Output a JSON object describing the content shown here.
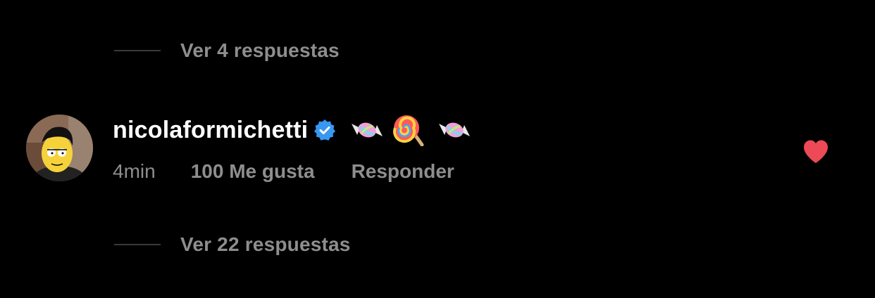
{
  "thread": {
    "replies_top": "Ver 4 respuestas",
    "replies_bottom": "Ver 22 respuestas"
  },
  "comment": {
    "username": "nicolaformichetti",
    "verified": true,
    "text_icons": [
      "candy-icon",
      "lollipop-icon",
      "candy-icon"
    ],
    "time": "4min",
    "likes": "100 Me gusta",
    "reply_label": "Responder",
    "liked": true
  },
  "colors": {
    "background": "#000000",
    "muted": "#8e8e8e",
    "verified": "#3897f0",
    "heart": "#ed4956"
  }
}
